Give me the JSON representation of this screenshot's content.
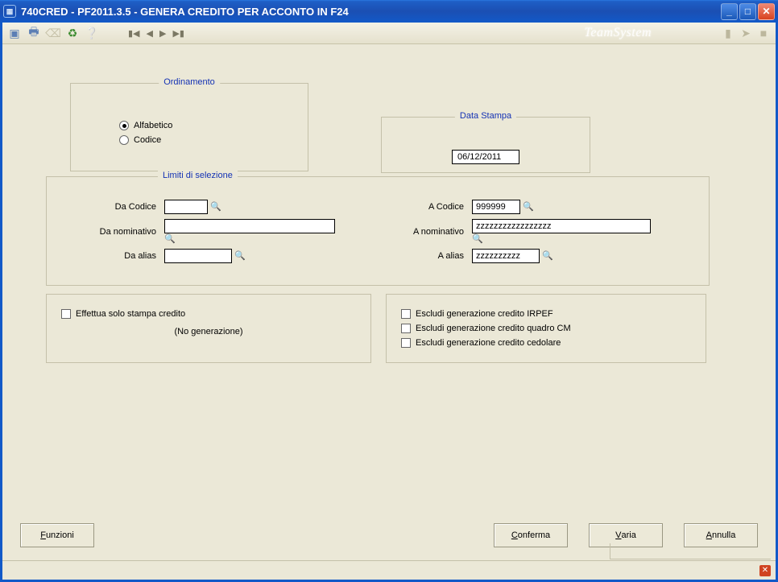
{
  "window": {
    "title": "740CRED  - PF2011.3.5 -  GENERA CREDITO PER ACCONTO IN F24"
  },
  "brand": "TeamSystem",
  "ordinamento": {
    "legend": "Ordinamento",
    "opt_alfabetico": "Alfabetico",
    "opt_codice": "Codice",
    "selected": "alfabetico"
  },
  "data_stampa": {
    "legend": "Data Stampa",
    "value": "06/12/2011"
  },
  "limiti": {
    "legend": "Limiti di selezione",
    "da_codice_lbl": "Da Codice",
    "da_codice_val": "",
    "da_nom_lbl": "Da nominativo",
    "da_nom_val": "",
    "da_alias_lbl": "Da alias",
    "da_alias_val": "",
    "a_codice_lbl": "A Codice",
    "a_codice_val": "999999",
    "a_nom_lbl": "A nominativo",
    "a_nom_val": "zzzzzzzzzzzzzzzzz",
    "a_alias_lbl": "A alias",
    "a_alias_val": "zzzzzzzzzz"
  },
  "options_left": {
    "chk1": "Effettua solo stampa credito",
    "note": "(No generazione)"
  },
  "options_right": {
    "chk1": "Escludi generazione credito IRPEF",
    "chk2": "Escludi generazione credito quadro CM",
    "chk3": "Escludi generazione credito cedolare"
  },
  "buttons": {
    "funzioni": "Funzioni",
    "conferma": "Conferma",
    "varia": "Varia",
    "annulla": "Annulla"
  }
}
